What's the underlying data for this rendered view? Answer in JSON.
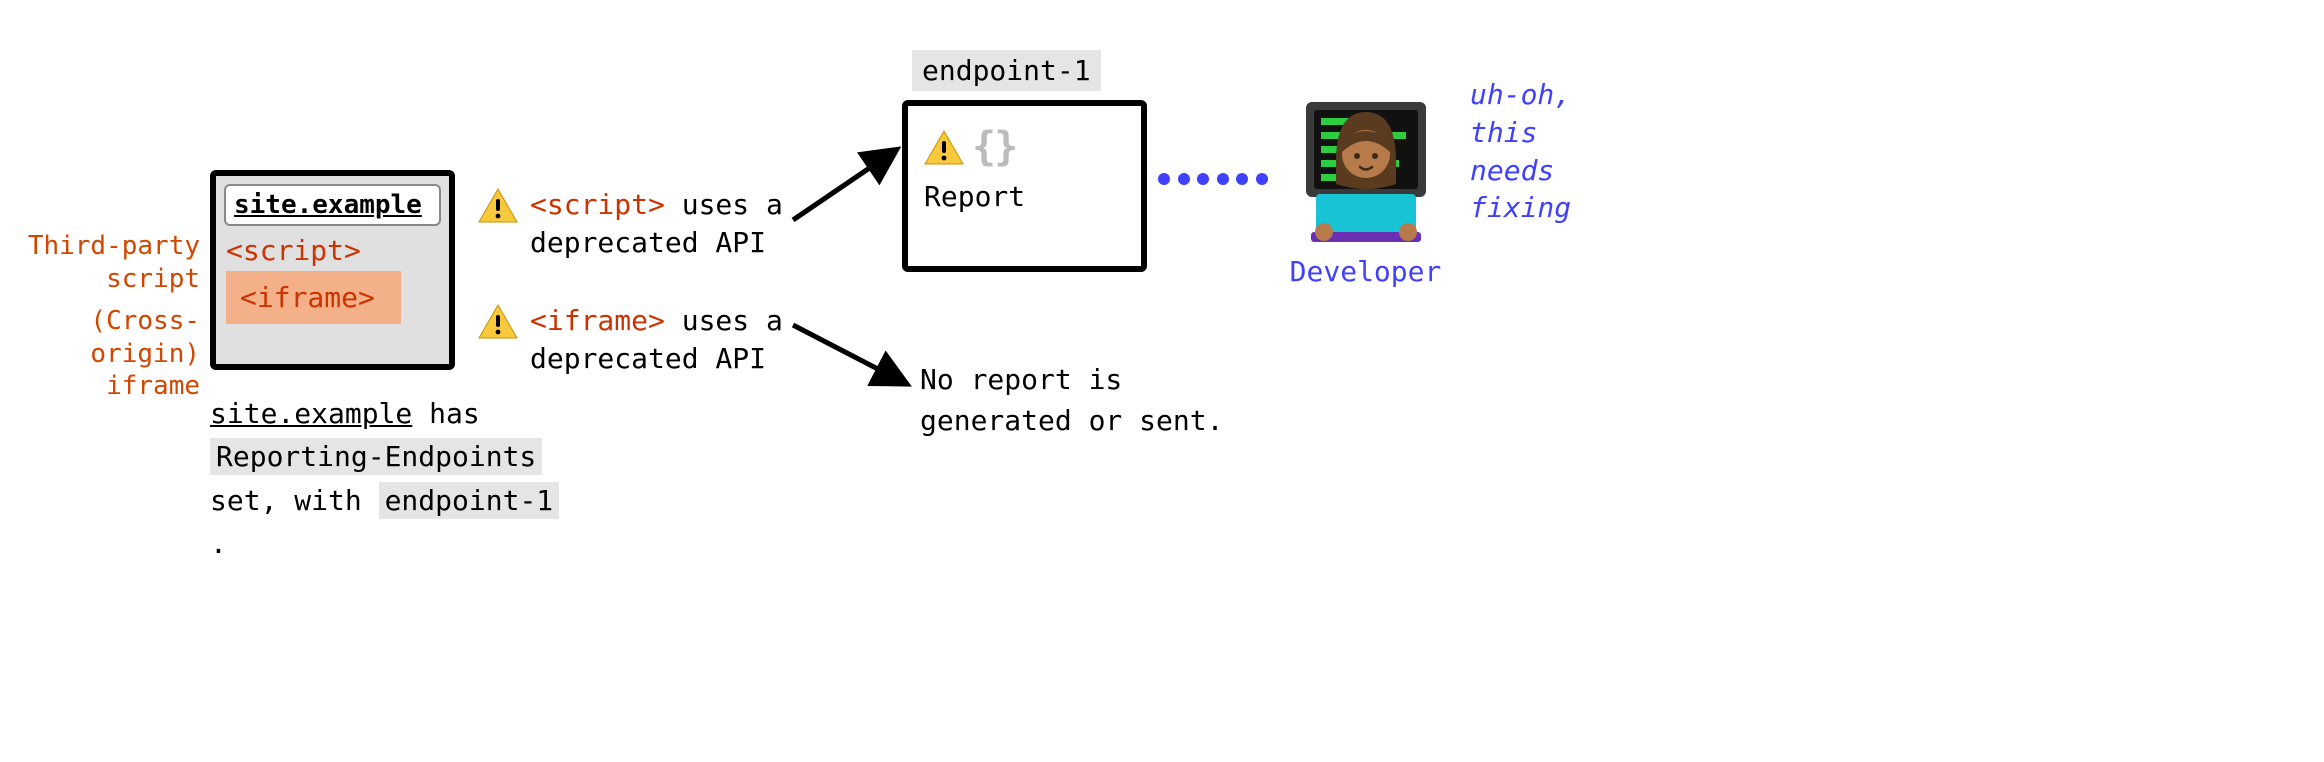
{
  "left_annotations": {
    "third_party_line1": "Third-party",
    "third_party_line2": "script",
    "cross_origin_line1": "(Cross-origin)",
    "cross_origin_line2": "iframe"
  },
  "browser": {
    "address": "site.example",
    "script_tag": "<script>",
    "iframe_tag": "<iframe>"
  },
  "caption": {
    "part1_ul": "site.example",
    "part1_tail": " has",
    "part2_hl": "Reporting-Endpoints",
    "part3_pre": "set, with ",
    "part3_hl": "endpoint-1",
    "part3_post": " ."
  },
  "warnings": {
    "script": {
      "tag": "<script>",
      "tail": " uses a",
      "line2": "deprecated API"
    },
    "iframe": {
      "tag": "<iframe>",
      "tail": " uses a",
      "line2": "deprecated API"
    }
  },
  "endpoint": {
    "label": "endpoint-1",
    "braces": "{}",
    "report": "Report"
  },
  "no_report": {
    "line1": "No report is",
    "line2": "generated or sent."
  },
  "developer": {
    "label": "Developer",
    "quote_l1": "uh-oh,",
    "quote_l2": "this",
    "quote_l3": "needs",
    "quote_l4": "fixing"
  },
  "icons": {
    "warning": "warning-icon",
    "braces": "braces-icon",
    "arrow_up": "arrow-up-icon",
    "arrow_down": "arrow-down-icon",
    "dots": "dots-connector-icon",
    "developer": "developer-avatar-icon"
  }
}
